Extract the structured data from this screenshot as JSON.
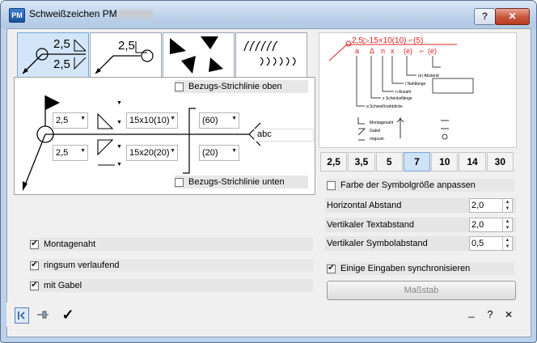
{
  "window": {
    "title": "Schweißzeichen  PM",
    "app_icon": "PM",
    "help_glyph": "?",
    "close_glyph": "✕"
  },
  "tabs": [
    {
      "id": "tab-1",
      "icon": "weld-arrow-both-sides-icon",
      "labels": [
        "2,5",
        "2,5"
      ]
    },
    {
      "id": "tab-2",
      "icon": "weld-arrow-single-icon",
      "labels": [
        "2,5"
      ]
    },
    {
      "id": "tab-3",
      "icon": "triangle-shapes-icon"
    },
    {
      "id": "tab-4",
      "icon": "weld-seam-pattern-icon"
    }
  ],
  "weld": {
    "ref_line_top_label": "Bezugs-Strichlinie oben",
    "ref_line_bottom_label": "Bezugs-Strichlinie unten",
    "top_size": "2,5",
    "bottom_size": "2,5",
    "top_dim": "15x10(10)",
    "bottom_dim": "15x20(20)",
    "top_pitch": "(60)",
    "bottom_pitch": "(20)",
    "tail_text": "abc",
    "arrow_glyph": "▼"
  },
  "options": [
    {
      "label": "Montagenaht",
      "checked": true
    },
    {
      "label": "ringsum verlaufend",
      "checked": true
    },
    {
      "label": "mit Gabel",
      "checked": true
    }
  ],
  "preview": {
    "header_text": "2,5▷15×10(10) ⌐(5)",
    "sub_labels": [
      "a",
      "Δ",
      "n",
      "x",
      "(e)",
      "⌐",
      "(e)"
    ],
    "legend_left": [
      "a Schweißnahtdicke",
      "z Schenkellänge",
      "n Anzahl",
      "l Nahtlänge",
      "(e) Abstand"
    ],
    "legend_right": [
      "Montagenaht",
      "Gabel",
      "ringsum"
    ]
  },
  "scale_buttons": [
    {
      "label": "2,5",
      "active": false
    },
    {
      "label": "3,5",
      "active": false
    },
    {
      "label": "5",
      "active": false
    },
    {
      "label": "7",
      "active": true
    },
    {
      "label": "10",
      "active": false
    },
    {
      "label": "14",
      "active": false
    },
    {
      "label": "30",
      "active": false
    }
  ],
  "right": {
    "symbol_size_label": "Farbe der Symbolgröße anpassen",
    "symbol_size_checked": false,
    "props": [
      {
        "label": "Horizontal Abstand",
        "value": "2,0"
      },
      {
        "label": "Vertikaler Textabstand",
        "value": "2,0"
      },
      {
        "label": "Vertikaler Symbolabstand",
        "value": "0,5"
      }
    ],
    "sync_label": "Einige Eingaben synchronisieren",
    "sync_checked": true,
    "massstab_label": "Maßstab"
  },
  "statusbar": {
    "minimize_glyph": "_",
    "help_glyph": "?",
    "close_glyph": "✕",
    "ok_glyph": "✓"
  }
}
